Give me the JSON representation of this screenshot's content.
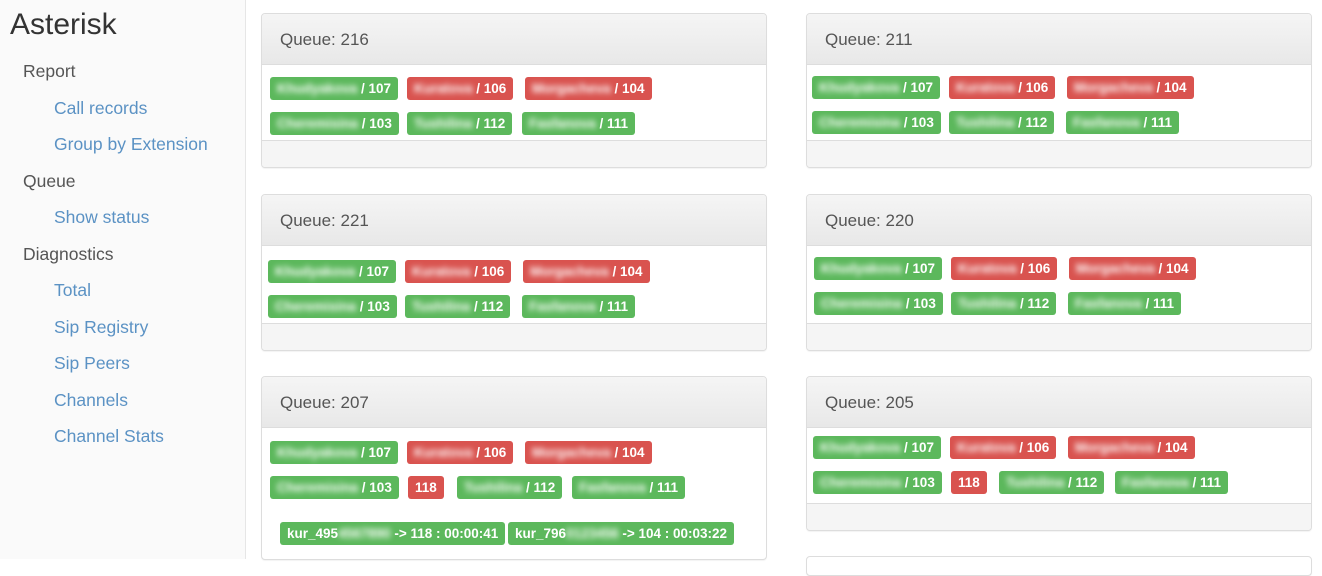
{
  "app": {
    "title": "Asterisk"
  },
  "sidebar": {
    "sections": [
      {
        "label": "Report",
        "items": [
          {
            "label": "Call records"
          },
          {
            "label": "Group by Extension"
          }
        ]
      },
      {
        "label": "Queue",
        "items": [
          {
            "label": "Show status"
          }
        ]
      },
      {
        "label": "Diagnostics",
        "items": [
          {
            "label": "Total"
          },
          {
            "label": "Sip Registry"
          },
          {
            "label": "Sip Peers"
          },
          {
            "label": "Channels"
          },
          {
            "label": "Channel Stats"
          }
        ]
      }
    ]
  },
  "colors": {
    "available": "#5cb85c",
    "busy": "#d9534f",
    "link": "#5b92c4"
  },
  "queues": [
    {
      "title": "Queue: 216",
      "agents": [
        {
          "name": "Khudyakova",
          "ext": " / 107",
          "color": "green"
        },
        {
          "name": "Kuratova",
          "ext": " / 106",
          "color": "red"
        },
        {
          "name": "Morgacheva",
          "ext": " / 104",
          "color": "red"
        },
        {
          "name": "Cheremisina",
          "ext": " / 103",
          "color": "green"
        },
        {
          "name": "Tushilina",
          "ext": " / 112",
          "color": "green"
        },
        {
          "name": "Fasfanova",
          "ext": " / 111",
          "color": "green"
        }
      ]
    },
    {
      "title": "Queue: 211",
      "agents": [
        {
          "name": "Khudyakova",
          "ext": " / 107",
          "color": "green"
        },
        {
          "name": "Kuratova",
          "ext": " / 106",
          "color": "red"
        },
        {
          "name": "Morgacheva",
          "ext": " / 104",
          "color": "red"
        },
        {
          "name": "Cheremisina",
          "ext": " / 103",
          "color": "green"
        },
        {
          "name": "Tushilina",
          "ext": " / 112",
          "color": "green"
        },
        {
          "name": "Fasfanova",
          "ext": " / 111",
          "color": "green"
        }
      ]
    },
    {
      "title": "Queue: 221",
      "agents": [
        {
          "name": "Khudyakova",
          "ext": " / 107",
          "color": "green"
        },
        {
          "name": "Kuratova",
          "ext": " / 106",
          "color": "red"
        },
        {
          "name": "Morgacheva",
          "ext": " / 104",
          "color": "red"
        },
        {
          "name": "Cheremisina",
          "ext": " / 103",
          "color": "green"
        },
        {
          "name": "Tushilina",
          "ext": " / 112",
          "color": "green"
        },
        {
          "name": "Fasfanova",
          "ext": " / 111",
          "color": "green"
        }
      ]
    },
    {
      "title": "Queue: 220",
      "agents": [
        {
          "name": "Khudyakova",
          "ext": " / 107",
          "color": "green"
        },
        {
          "name": "Kuratova",
          "ext": " / 106",
          "color": "red"
        },
        {
          "name": "Morgacheva",
          "ext": " / 104",
          "color": "red"
        },
        {
          "name": "Cheremisina",
          "ext": " / 103",
          "color": "green"
        },
        {
          "name": "Tushilina",
          "ext": " / 112",
          "color": "green"
        },
        {
          "name": "Fasfanova",
          "ext": " / 111",
          "color": "green"
        }
      ]
    },
    {
      "title": "Queue: 207",
      "agents": [
        {
          "name": "Khudyakova",
          "ext": " / 107",
          "color": "green"
        },
        {
          "name": "Kuratova",
          "ext": " / 106",
          "color": "red"
        },
        {
          "name": "Morgacheva",
          "ext": " / 104",
          "color": "red"
        },
        {
          "name": "Cheremisina",
          "ext": " / 103",
          "color": "green"
        },
        {
          "name": "",
          "ext": "118",
          "color": "red"
        },
        {
          "name": "Tushilina",
          "ext": " / 112",
          "color": "green"
        },
        {
          "name": "Fasfanova",
          "ext": " / 111",
          "color": "green"
        }
      ],
      "calls": [
        {
          "prefix": "kur_495",
          "masked": "4567890",
          "rest": " -> 118 : 00:00:41"
        },
        {
          "prefix": "kur_796",
          "masked": "0123456",
          "rest": " -> 104 : 00:03:22"
        }
      ]
    },
    {
      "title": "Queue: 205",
      "agents": [
        {
          "name": "Khudyakova",
          "ext": " / 107",
          "color": "green"
        },
        {
          "name": "Kuratova",
          "ext": " / 106",
          "color": "red"
        },
        {
          "name": "Morgacheva",
          "ext": " / 104",
          "color": "red"
        },
        {
          "name": "Cheremisina",
          "ext": " / 103",
          "color": "green"
        },
        {
          "name": "",
          "ext": "118",
          "color": "red"
        },
        {
          "name": "Tushilina",
          "ext": " / 112",
          "color": "green"
        },
        {
          "name": "Fasfanova",
          "ext": " / 111",
          "color": "green"
        }
      ]
    }
  ]
}
